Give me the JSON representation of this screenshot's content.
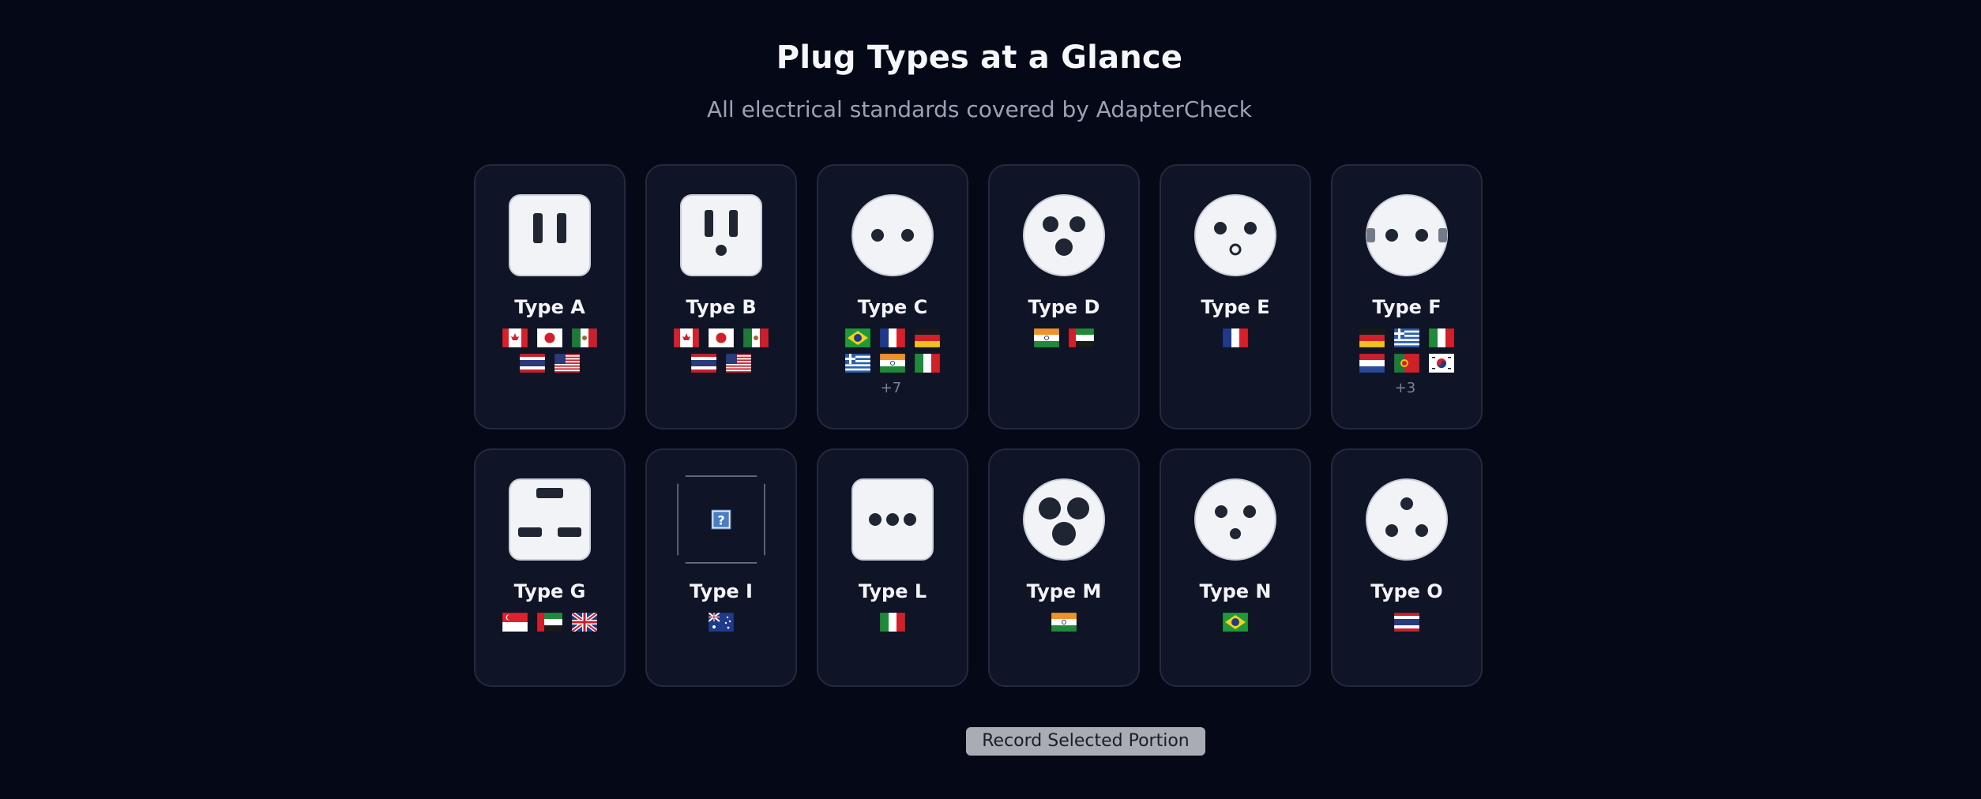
{
  "page": {
    "title": "Plug Types at a Glance",
    "subtitle": "All electrical standards covered by AdapterCheck"
  },
  "plugs": [
    {
      "label": "Type A",
      "icon": "outlet-type-a-icon",
      "flags": [
        "ca",
        "jp",
        "mx",
        "th",
        "us"
      ],
      "more": ""
    },
    {
      "label": "Type B",
      "icon": "outlet-type-b-icon",
      "flags": [
        "ca",
        "jp",
        "mx",
        "th",
        "us"
      ],
      "more": ""
    },
    {
      "label": "Type C",
      "icon": "outlet-type-c-icon",
      "flags": [
        "br",
        "fr",
        "de",
        "gr",
        "in",
        "it"
      ],
      "more": "+7"
    },
    {
      "label": "Type D",
      "icon": "outlet-type-d-icon",
      "flags": [
        "in",
        "ae"
      ],
      "more": ""
    },
    {
      "label": "Type E",
      "icon": "outlet-type-e-icon",
      "flags": [
        "fr"
      ],
      "more": ""
    },
    {
      "label": "Type F",
      "icon": "outlet-type-f-icon",
      "flags": [
        "de",
        "gr",
        "it",
        "nl",
        "pt",
        "kr"
      ],
      "more": "+3"
    },
    {
      "label": "Type G",
      "icon": "outlet-type-g-icon",
      "flags": [
        "sg",
        "ae",
        "gb"
      ],
      "more": ""
    },
    {
      "label": "Type I",
      "icon": "missing-image-icon",
      "flags": [
        "au"
      ],
      "more": ""
    },
    {
      "label": "Type L",
      "icon": "outlet-type-l-icon",
      "flags": [
        "it"
      ],
      "more": ""
    },
    {
      "label": "Type M",
      "icon": "outlet-type-m-icon",
      "flags": [
        "in"
      ],
      "more": ""
    },
    {
      "label": "Type N",
      "icon": "outlet-type-n-icon",
      "flags": [
        "br"
      ],
      "more": ""
    },
    {
      "label": "Type O",
      "icon": "outlet-type-o-icon",
      "flags": [
        "th"
      ],
      "more": ""
    }
  ],
  "actions": {
    "record_label": "Record Selected Portion"
  },
  "colors": {
    "background": "#050816",
    "card": "#0f1426",
    "card_border": "#232a3e",
    "socket_face": "#f1f3f6",
    "socket_hole": "#1f2533",
    "button": "#a9acb4"
  }
}
